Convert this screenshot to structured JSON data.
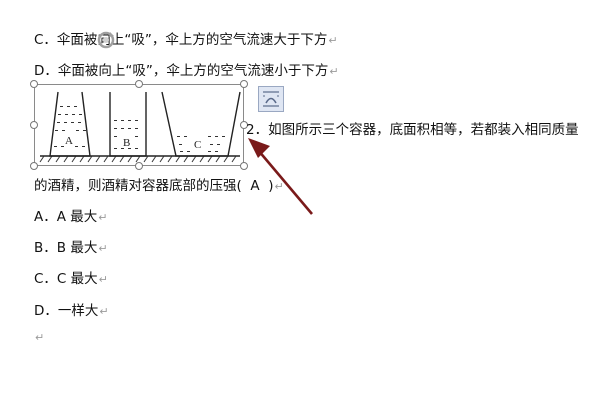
{
  "lines": {
    "c_prev": "C．伞面被向上“吸”，伞上方的空气流速大于下方",
    "d_prev": "D．伞面被向上“吸”，伞上方的空气流速小于下方",
    "q2_a": "2．如图所示三个容器，底面积相等，若都装入相同质量",
    "q2_b": "的酒精，则酒精对容器底部的压强(",
    "q2_answer": "A",
    "q2_close": ")",
    "opt_a": "A．A 最大",
    "opt_b": "B．B 最大",
    "opt_c": "C．C 最大",
    "opt_d": "D．一样大"
  },
  "figure": {
    "labels": [
      "A",
      "B",
      "C"
    ]
  },
  "para_mark": "↵",
  "colors": {
    "arrow": "#7a1a1a",
    "handle_border": "#777777",
    "selection_border": "#8a8a8a"
  },
  "icons": [
    "rotate-icon",
    "layout-options-icon",
    "paragraph-mark-icon"
  ]
}
